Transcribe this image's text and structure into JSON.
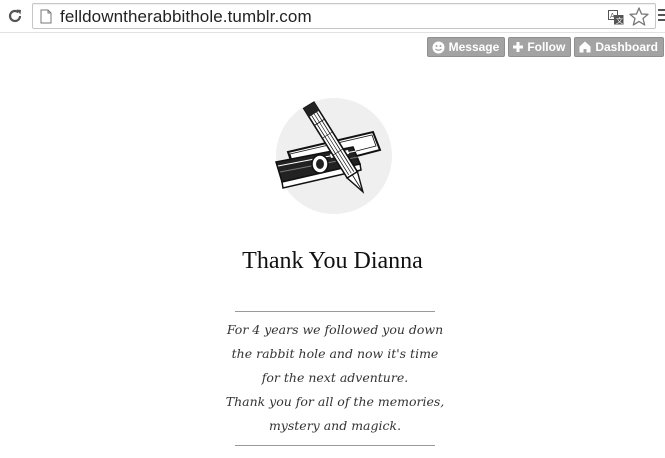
{
  "browser": {
    "url": "felldowntherabbithole.tumblr.com"
  },
  "tumblr_controls": {
    "message_label": "Message",
    "follow_label": "Follow",
    "dashboard_label": "Dashboard"
  },
  "blog": {
    "title": "Thank You Dianna",
    "description_lines": [
      "For 4 years we followed you down",
      "the rabbit hole and now it's time",
      "for the next adventure.",
      "Thank you for all of the memories,",
      "mystery and magick."
    ]
  },
  "colors": {
    "control_button_bg": "#a3a3a3",
    "logo_circle": "#efefef",
    "rule": "#999999"
  }
}
